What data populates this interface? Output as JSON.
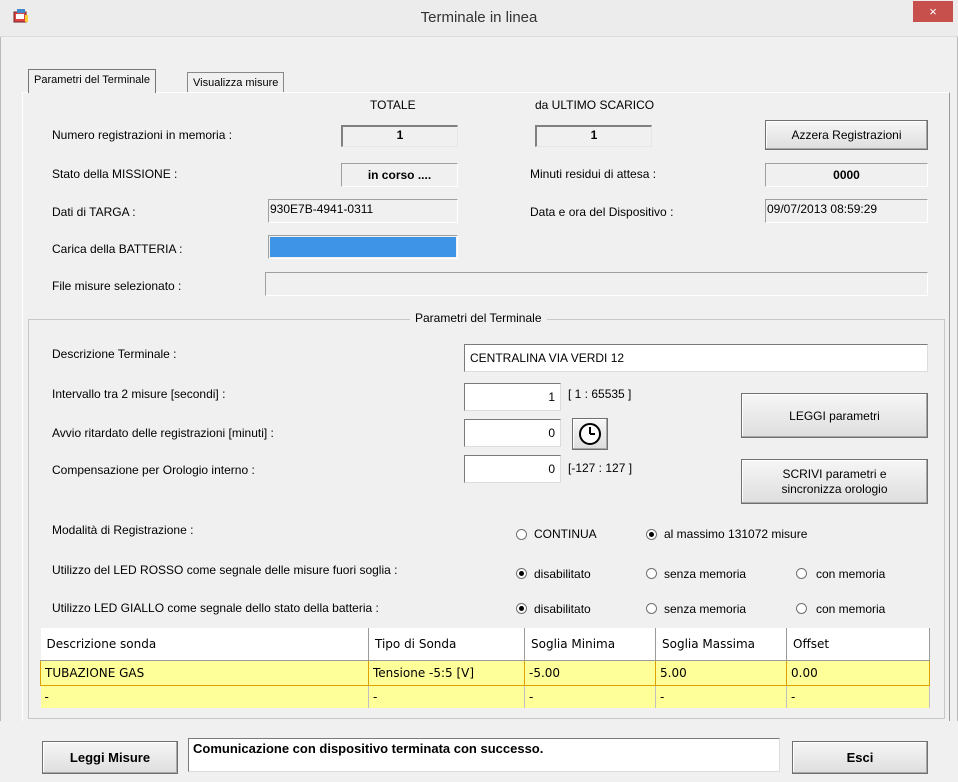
{
  "window": {
    "title": "Terminale in linea",
    "close": "×"
  },
  "tabs": [
    "Parametri del Terminale",
    "Visualizza misure"
  ],
  "header": {
    "totale": "TOTALE",
    "ultimo": "da ULTIMO SCARICO"
  },
  "rows": {
    "num_reg_label": "Numero registrazioni in memoria :",
    "num_reg_total": "1",
    "num_reg_last": "1",
    "azzera_button": "Azzera Registrazioni",
    "stato_label": "Stato della MISSIONE :",
    "stato_value": "in corso ....",
    "minuti_label": "Minuti residui di attesa  :",
    "minuti_value": "0000",
    "targa_label": "Dati di TARGA :",
    "targa_value": "930E7B-4941-0311",
    "data_label": "Data e ora del Dispositivo :",
    "data_value": "09/07/2013   08:59:29",
    "batteria_label": "Carica della BATTERIA :",
    "batteria_level": 1.0,
    "batteria_color": "#3e95e8",
    "file_label": "File misure selezionato :",
    "file_value": ""
  },
  "params": {
    "group_title": "Parametri del Terminale",
    "descrizione_label": "Descrizione Terminale :",
    "descrizione_value": "CENTRALINA  VIA  VERDI 12",
    "intervallo_label": "Intervallo tra 2 misure  [secondi] :",
    "intervallo_value": "1",
    "intervallo_range": "[ 1 : 65535 ]",
    "avvio_label": "Avvio ritardato delle registrazioni  [minuti] :",
    "avvio_value": "0",
    "clock_icon": "clock-icon",
    "comp_label": "Compensazione per Orologio interno :",
    "comp_value": "0",
    "comp_range": "[-127 : 127 ]",
    "leggi_button": "LEGGI parametri",
    "scrivi_button_line1": "SCRIVI parametri e",
    "scrivi_button_line2": "sincronizza orologio",
    "modalita_label": "Modalità di Registrazione :",
    "modalita_opt1": "CONTINUA",
    "modalita_opt2": "al massimo 131072 misure",
    "led_rosso_label": "Utilizzo del LED ROSSO come segnale delle misure fuori soglia :",
    "led_giallo_label": "Utilizzo LED GIALLO come segnale dello stato della batteria :",
    "opt_disabilitato": "disabilitato",
    "opt_senza": "senza memoria",
    "opt_con": "con memoria"
  },
  "table": {
    "headers": [
      "Descrizione sonda",
      "Tipo di Sonda",
      "Soglia Minima",
      "Soglia Massima",
      "Offset"
    ],
    "rows": [
      [
        "TUBAZIONE GAS",
        "Tensione  -5:5 [V]",
        "-5.00",
        "5.00",
        "0.00"
      ],
      [
        "-",
        "-",
        "-",
        "-",
        "-"
      ]
    ]
  },
  "footer": {
    "leggi_misure": "Leggi Misure",
    "status": "Comunicazione con dispositivo terminata con successo.",
    "esci": "Esci"
  }
}
